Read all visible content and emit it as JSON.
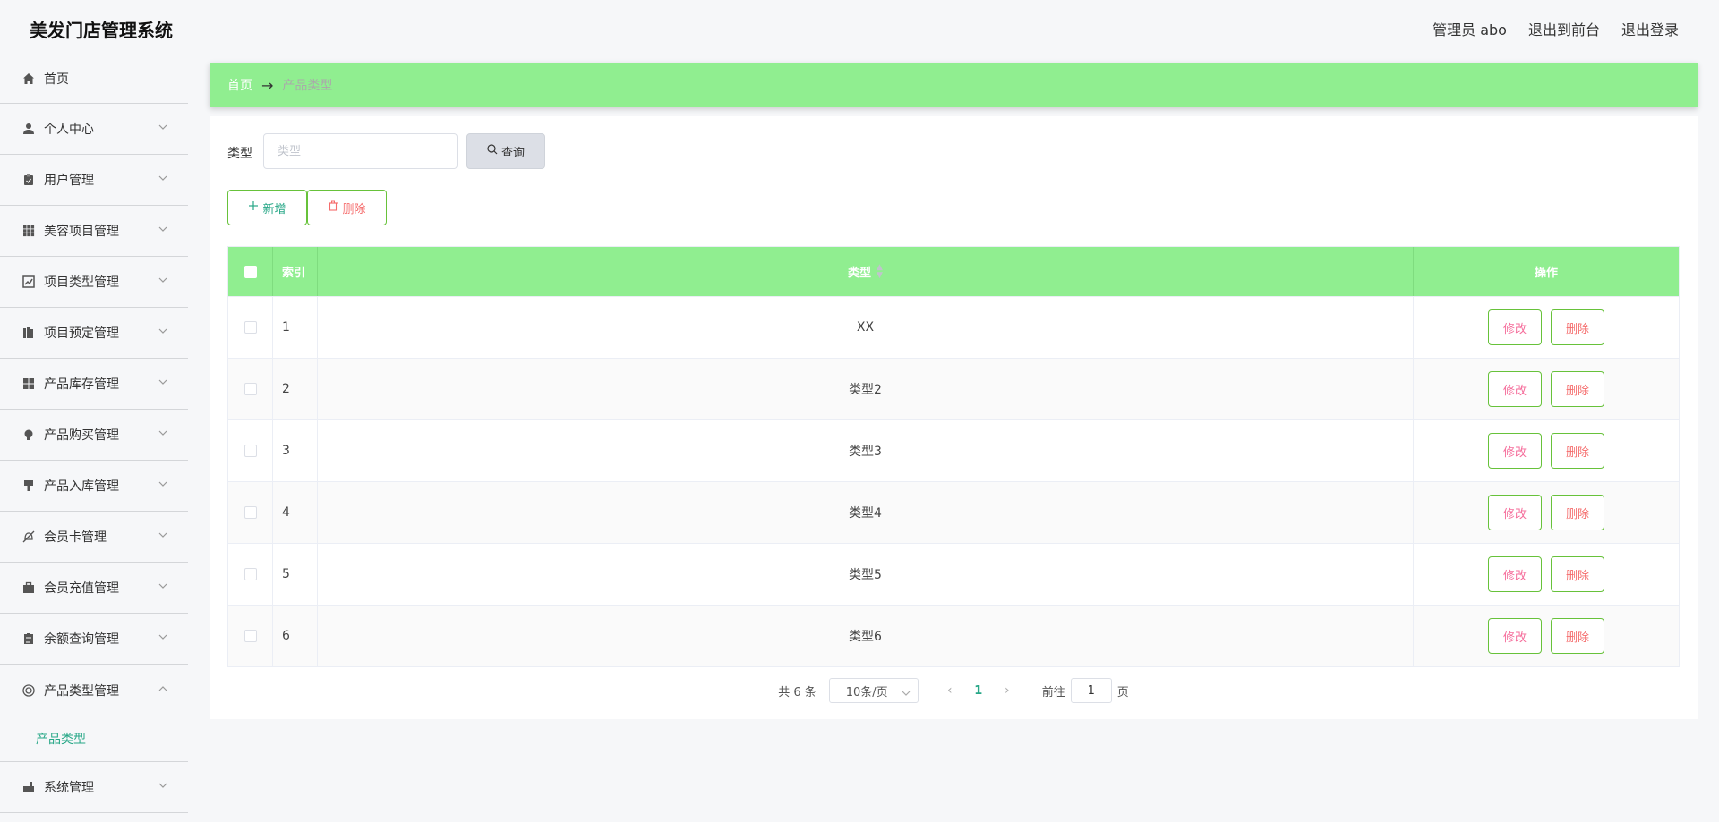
{
  "header": {
    "app_title": "美发门店管理系统",
    "admin_label": "管理员 abo",
    "to_frontend": "退出到前台",
    "logout": "退出登录"
  },
  "sidebar": {
    "items": [
      {
        "label": "首页",
        "icon": "home-icon"
      },
      {
        "label": "个人中心",
        "icon": "user-icon"
      },
      {
        "label": "用户管理",
        "icon": "clipboard-icon"
      },
      {
        "label": "美容项目管理",
        "icon": "grid-icon"
      },
      {
        "label": "项目类型管理",
        "icon": "chart-icon"
      },
      {
        "label": "项目预定管理",
        "icon": "books-icon"
      },
      {
        "label": "产品库存管理",
        "icon": "apps-icon"
      },
      {
        "label": "产品购买管理",
        "icon": "bulb-icon"
      },
      {
        "label": "产品入库管理",
        "icon": "brush-icon"
      },
      {
        "label": "会员卡管理",
        "icon": "bell-off-icon"
      },
      {
        "label": "会员充值管理",
        "icon": "briefcase-icon"
      },
      {
        "label": "余额查询管理",
        "icon": "document-icon"
      },
      {
        "label": "产品类型管理",
        "icon": "lifebuoy-icon"
      },
      {
        "label": "系统管理",
        "icon": "settings-icon"
      }
    ],
    "active_sub": "产品类型"
  },
  "breadcrumb": {
    "home": "首页",
    "arrow": "→",
    "current": "产品类型"
  },
  "search": {
    "label": "类型",
    "placeholder": "类型",
    "value": "",
    "button": "查询"
  },
  "actions": {
    "add": "新增",
    "delete": "删除"
  },
  "table": {
    "headers": {
      "index": "索引",
      "type": "类型",
      "ops": "操作"
    },
    "rows": [
      {
        "index": "1",
        "type": "XX"
      },
      {
        "index": "2",
        "type": "类型2"
      },
      {
        "index": "3",
        "type": "类型3"
      },
      {
        "index": "4",
        "type": "类型4"
      },
      {
        "index": "5",
        "type": "类型5"
      },
      {
        "index": "6",
        "type": "类型6"
      }
    ],
    "edit_label": "修改",
    "delete_label": "删除"
  },
  "pagination": {
    "total_text": "共 6 条",
    "page_size": "10条/页",
    "current_page": "1",
    "goto_label": "前往",
    "goto_value": "1",
    "page_suffix": "页"
  },
  "colors": {
    "accent": "#90ee90",
    "active_text": "#27a787",
    "danger": "#f56c6c"
  }
}
